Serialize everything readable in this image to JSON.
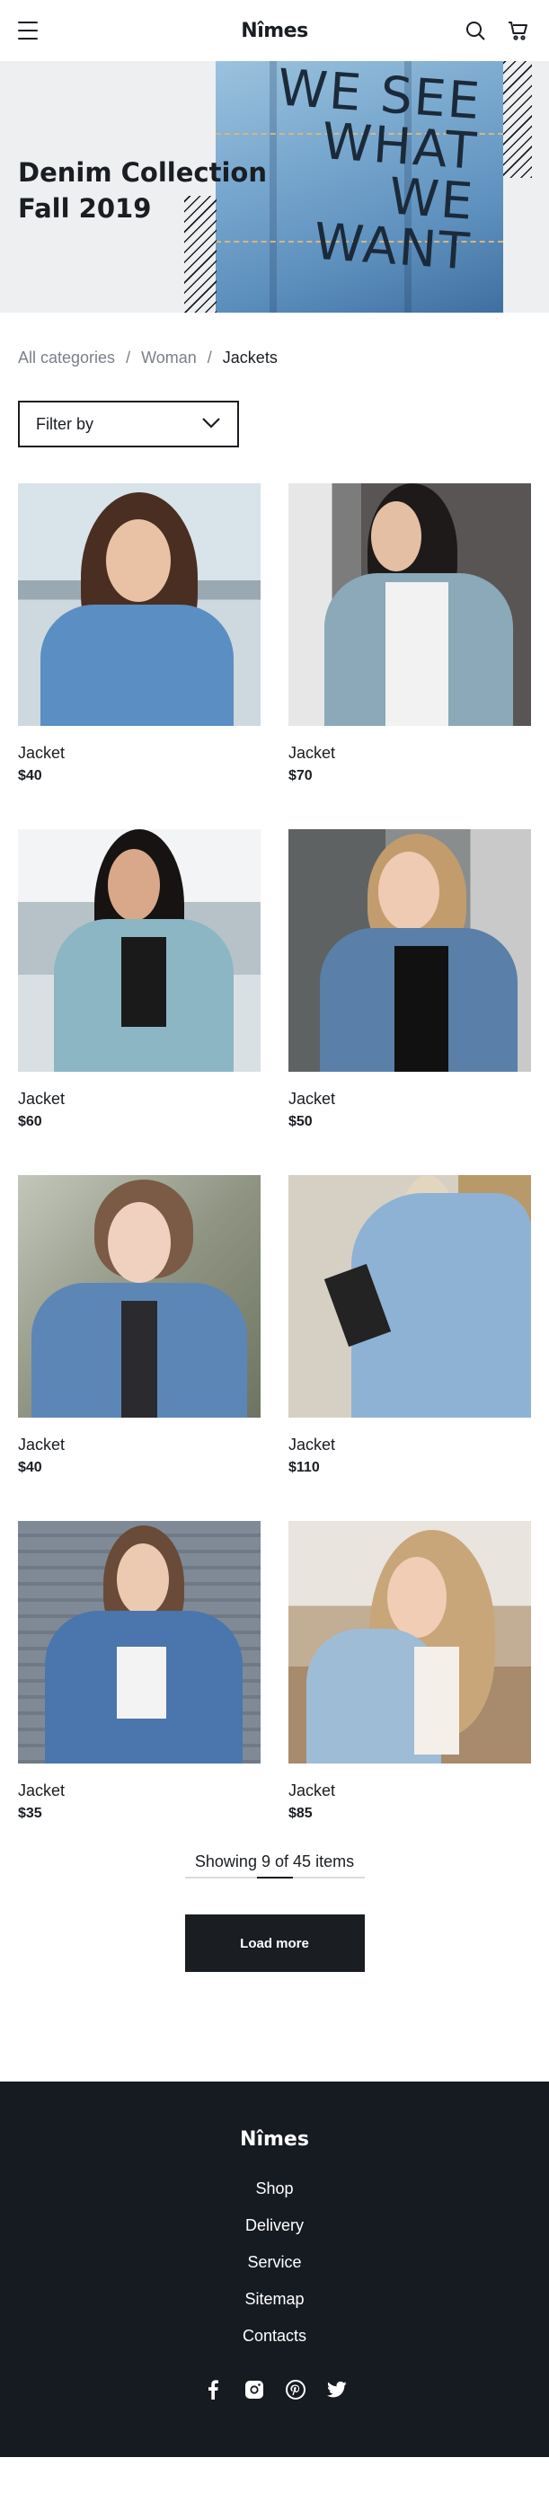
{
  "header": {
    "logo": "Nîmes",
    "menu_icon": "hamburger-menu-icon",
    "search_icon": "search-icon",
    "cart_icon": "shopping-cart-icon"
  },
  "hero": {
    "title_line1": "Denim Collection",
    "title_line2": "Fall 2019",
    "image_text": [
      "WE SEE",
      "WHAT",
      "WE",
      "WANT"
    ]
  },
  "breadcrumb": {
    "items": [
      "All categories",
      "Woman",
      "Jackets"
    ],
    "separator": "/"
  },
  "filter": {
    "label": "Filter by",
    "icon": "chevron-down-icon"
  },
  "products": [
    {
      "name": "Jacket",
      "price": "$40"
    },
    {
      "name": "Jacket",
      "price": "$70"
    },
    {
      "name": "Jacket",
      "price": "$60"
    },
    {
      "name": "Jacket",
      "price": "$50"
    },
    {
      "name": "Jacket",
      "price": "$40"
    },
    {
      "name": "Jacket",
      "price": "$110"
    },
    {
      "name": "Jacket",
      "price": "$35"
    },
    {
      "name": "Jacket",
      "price": "$85"
    }
  ],
  "pagination": {
    "showing_prefix": "Showing",
    "shown": "9",
    "of_word": "of",
    "total": "45",
    "items_word": "items",
    "progress_fraction": 0.2,
    "load_more_label": "Load more"
  },
  "footer": {
    "logo": "Nîmes",
    "links": [
      "Shop",
      "Delivery",
      "Service",
      "Sitemap",
      "Contacts"
    ],
    "social_icons": [
      "facebook-icon",
      "instagram-icon",
      "pinterest-icon",
      "twitter-icon"
    ]
  },
  "colors": {
    "text": "#1a1d22",
    "muted": "#7a8089",
    "hero_bg": "#eeeff0",
    "footer_bg": "#161b22",
    "denim": "#5d8fbd"
  }
}
